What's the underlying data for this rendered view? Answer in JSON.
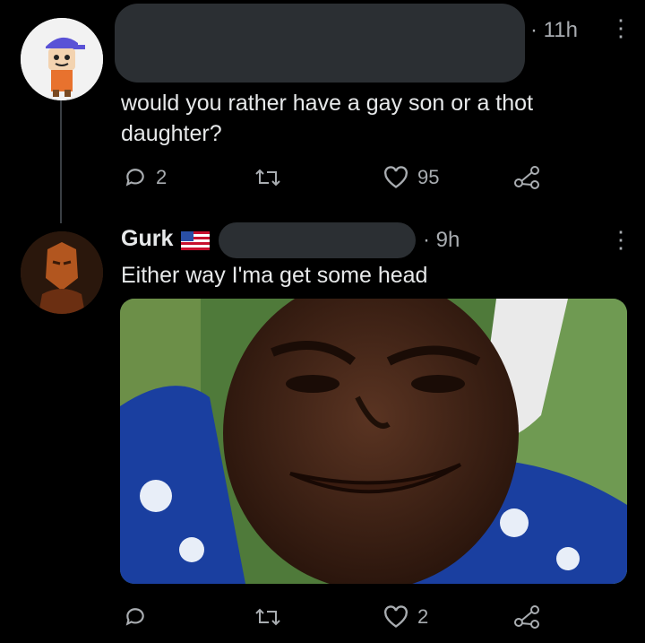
{
  "tweet1": {
    "time": "· 11h",
    "text": "would you rather have a gay son or a thot daughter?",
    "reply_count": "2",
    "retweet_count": "",
    "like_count": "95"
  },
  "tweet2": {
    "display_name": "Gurk",
    "time": "· 9h",
    "text": "Either way I'ma get some head",
    "reply_count": "",
    "retweet_count": "",
    "like_count": "2"
  },
  "icons": {
    "more": "more-vertical-icon",
    "reply": "reply-bubble-icon",
    "retweet": "retweet-icon",
    "like": "heart-icon",
    "share": "share-icon"
  },
  "colors": {
    "background": "#000000",
    "text": "#e7e9ea",
    "muted": "#a9adb1",
    "redaction": "#2b2f33"
  }
}
